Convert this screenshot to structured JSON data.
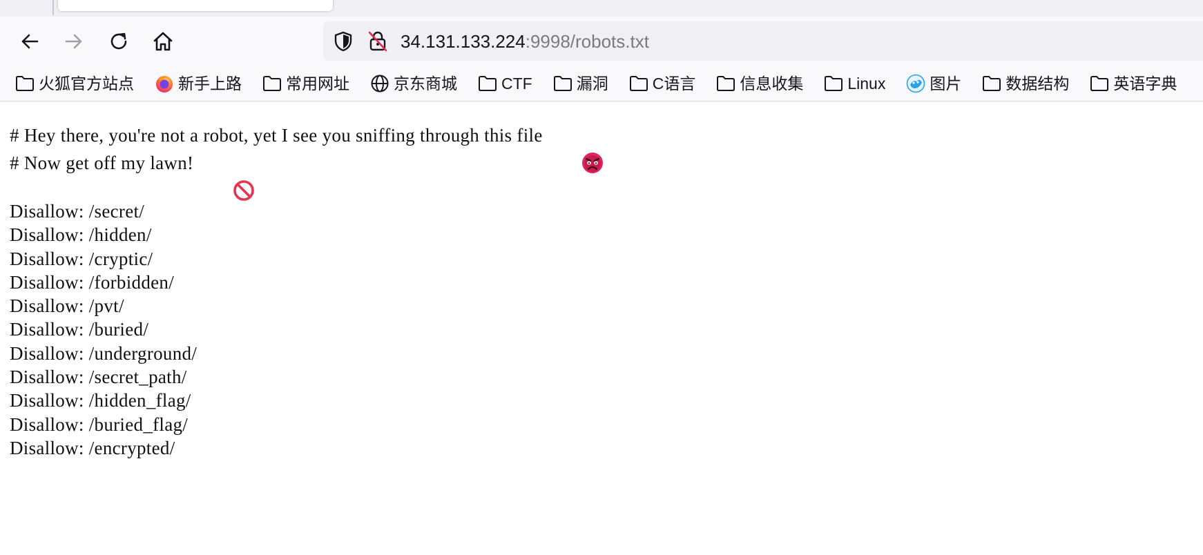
{
  "browser": {
    "tab_strip": {},
    "toolbar": {
      "back_icon": "arrow-left-icon",
      "forward_icon": "arrow-right-icon",
      "reload_icon": "reload-icon",
      "home_icon": "home-icon",
      "url": {
        "host": "34.131.133.224",
        "rest": ":9998/robots.txt",
        "shield_icon": "shield-icon",
        "insecure_icon": "insecure-lock-icon"
      }
    },
    "bookmarks": [
      {
        "label": "火狐官方站点",
        "icon": "folder-icon"
      },
      {
        "label": "新手上路",
        "icon": "firefox-icon"
      },
      {
        "label": "常用网址",
        "icon": "folder-icon"
      },
      {
        "label": "京东商城",
        "icon": "globe-icon"
      },
      {
        "label": "CTF",
        "icon": "folder-icon"
      },
      {
        "label": "漏洞",
        "icon": "folder-icon"
      },
      {
        "label": "C语言",
        "icon": "folder-icon"
      },
      {
        "label": "信息收集",
        "icon": "folder-icon"
      },
      {
        "label": "Linux",
        "icon": "folder-icon"
      },
      {
        "label": "图片",
        "icon": "image-site-icon"
      },
      {
        "label": "数据结构",
        "icon": "folder-icon"
      },
      {
        "label": "英语字典",
        "icon": "folder-icon"
      }
    ]
  },
  "page": {
    "comments": [
      {
        "text": "# Hey there, you're not a robot, yet I see you sniffing through this file",
        "emoji": "angry-face-icon"
      },
      {
        "text": "# Now get off my lawn!",
        "emoji": "prohibited-icon"
      }
    ],
    "rules": [
      "Disallow: /secret/",
      "Disallow: /hidden/",
      "Disallow: /cryptic/",
      "Disallow: /forbidden/",
      "Disallow: /pvt/",
      "Disallow: /buried/",
      "Disallow: /underground/",
      "Disallow: /secret_path/",
      "Disallow: /hidden_flag/",
      "Disallow: /buried_flag/",
      "Disallow: /encrypted/"
    ]
  },
  "colors": {
    "chrome_bg": "#f9f9fb",
    "tabstrip_bg": "#f0f0f4",
    "urlbar_bg": "#f0f0f4",
    "insecure_red": "#e22850",
    "text": "#15141a",
    "url_rest": "#7a7a80"
  }
}
